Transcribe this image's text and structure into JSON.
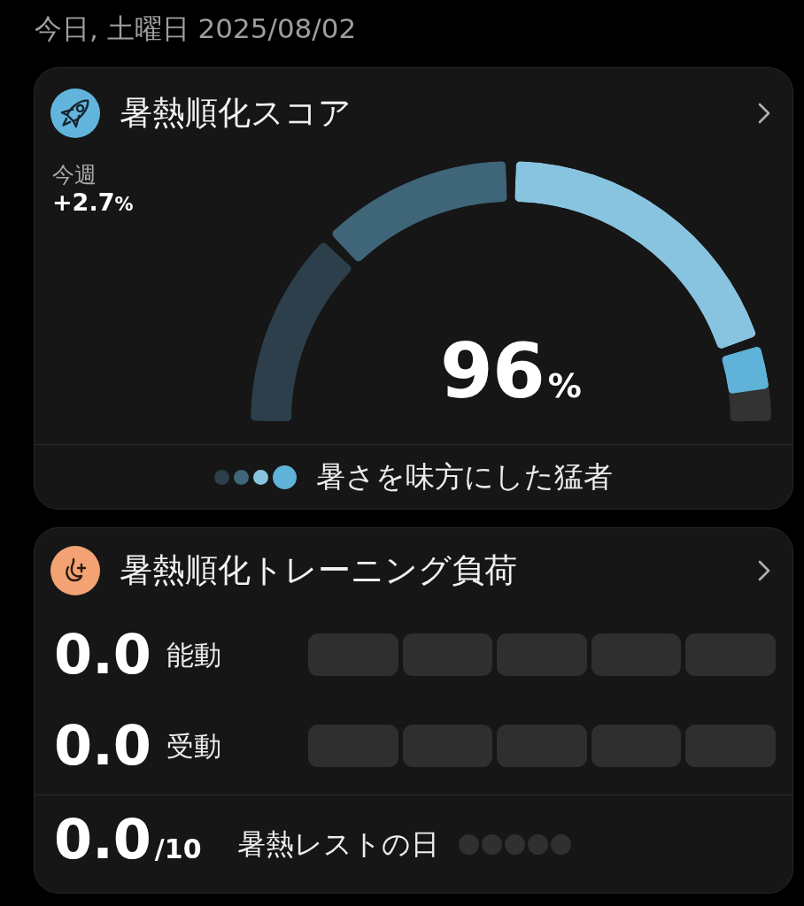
{
  "date": "今日, 土曜日 2025/08/02",
  "score_card": {
    "title": "暑熱順化スコア",
    "weekly": {
      "label": "今週",
      "value": "+2.7",
      "unit": "%"
    },
    "gauge": {
      "value": "96",
      "unit": "%",
      "level": 0.96,
      "zones": [
        {
          "color": "#2c3f4b"
        },
        {
          "color": "#3e6578"
        },
        {
          "color": "#88c4df"
        },
        {
          "color": "#5fb2d8"
        }
      ]
    },
    "status": {
      "dots": [
        {
          "color": "#2c3f4b",
          "selected": false
        },
        {
          "color": "#3e6578",
          "selected": false
        },
        {
          "color": "#88c4df",
          "selected": false
        },
        {
          "color": "#5fb2d8",
          "selected": true
        }
      ],
      "label": "暑さを味方にした猛者"
    }
  },
  "load_card": {
    "title": "暑熱順化トレーニング負荷",
    "rows": [
      {
        "value": "0.0",
        "label": "能動",
        "segments": [
          {
            "filled": false
          },
          {
            "filled": false
          },
          {
            "filled": false
          },
          {
            "filled": false
          },
          {
            "filled": false
          }
        ]
      },
      {
        "value": "0.0",
        "label": "受動",
        "segments": [
          {
            "filled": false
          },
          {
            "filled": false
          },
          {
            "filled": false
          },
          {
            "filled": false
          },
          {
            "filled": false
          }
        ]
      }
    ],
    "rest": {
      "value": "0.0",
      "denominator": "/10",
      "label": "暑熱レストの日",
      "dots": [
        {
          "filled": false
        },
        {
          "filled": false
        },
        {
          "filled": false
        },
        {
          "filled": false
        },
        {
          "filled": false
        }
      ]
    }
  }
}
